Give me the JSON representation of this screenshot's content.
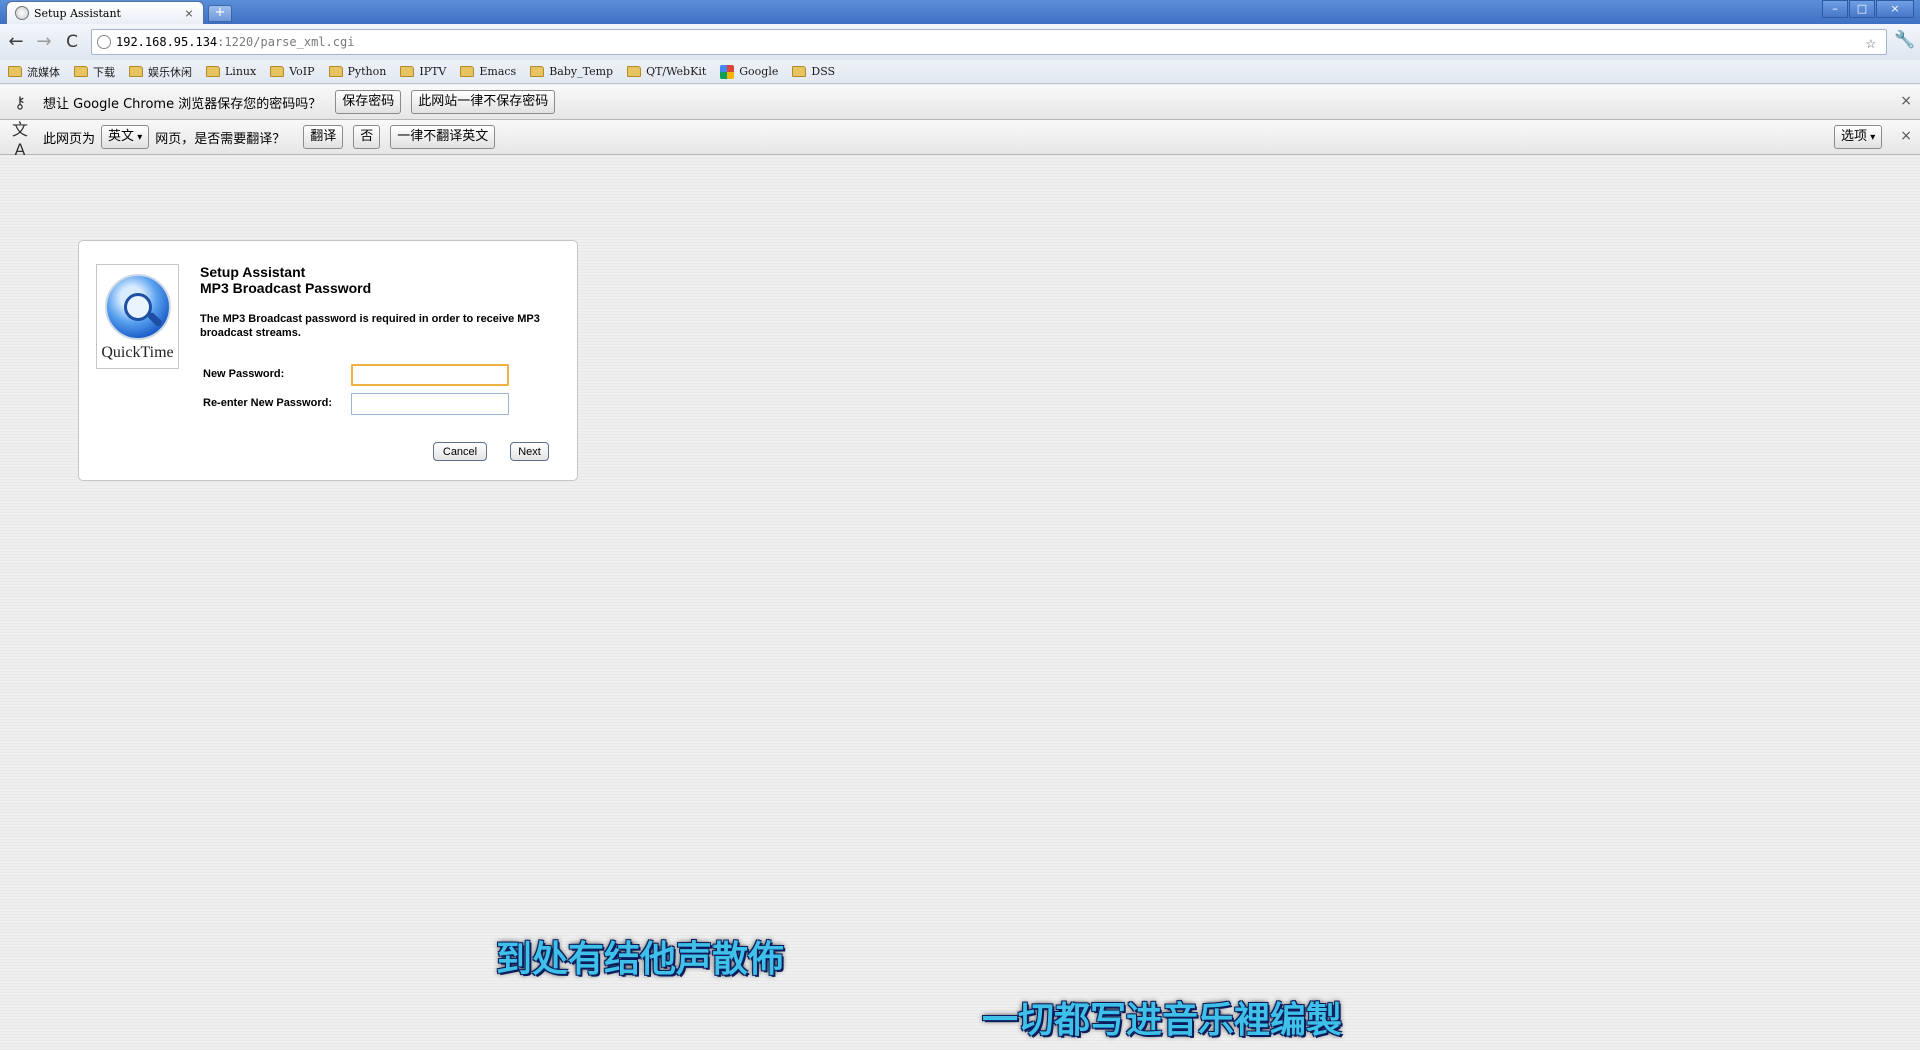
{
  "window": {
    "tab_title": "Setup Assistant",
    "tab_close": "×",
    "new_tab": "+",
    "controls": {
      "minimize": "–",
      "maximize": "□",
      "close": "×"
    }
  },
  "toolbar": {
    "back": "←",
    "forward": "→",
    "reload": "C",
    "url_host": "192.168.95.134",
    "url_path": ":1220/parse_xml.cgi",
    "star": "☆",
    "wrench": "🔧"
  },
  "bookmarks": [
    {
      "label": "流媒体",
      "icon": "folder-icon"
    },
    {
      "label": "下载",
      "icon": "folder-icon"
    },
    {
      "label": "娱乐休闲",
      "icon": "folder-icon"
    },
    {
      "label": "Linux",
      "icon": "folder-icon"
    },
    {
      "label": "VoIP",
      "icon": "folder-icon"
    },
    {
      "label": "Python",
      "icon": "folder-icon"
    },
    {
      "label": "IPTV",
      "icon": "folder-icon"
    },
    {
      "label": "Emacs",
      "icon": "folder-icon"
    },
    {
      "label": "Baby_Temp",
      "icon": "folder-icon"
    },
    {
      "label": "QT/WebKit",
      "icon": "folder-icon"
    },
    {
      "label": "Google",
      "icon": "google-icon"
    },
    {
      "label": "DSS",
      "icon": "folder-icon"
    }
  ],
  "password_bar": {
    "message": "想让 Google Chrome 浏览器保存您的密码吗？",
    "save_label": "保存密码",
    "never_label": "此网站一律不保存密码",
    "close": "×"
  },
  "translate_bar": {
    "prefix": "此网页为",
    "language": "英文",
    "suffix": "网页，是否需要翻译？",
    "translate_label": "翻译",
    "no_label": "否",
    "never_label": "一律不翻译英文",
    "options_label": "选项",
    "close": "×"
  },
  "dialog": {
    "logo_text": "QuickTime",
    "title": "Setup Assistant",
    "subtitle": "MP3 Broadcast Password",
    "description": "The MP3 Broadcast password is required in order to receive MP3 broadcast streams.",
    "new_password_label": "New Password:",
    "new_password_value": "",
    "reenter_label": "Re-enter New Password:",
    "reenter_value": "",
    "cancel_label": "Cancel",
    "next_label": "Next"
  },
  "overlay": {
    "line1": "到处有结他声散佈",
    "line2": "一切都写进音乐裡编製"
  },
  "colors": {
    "titlebar": "#3d70c2",
    "focus_ring": "#f0b044",
    "subtitle_fill": "#3ec0e8",
    "subtitle_outline": "#0a1c5c"
  }
}
